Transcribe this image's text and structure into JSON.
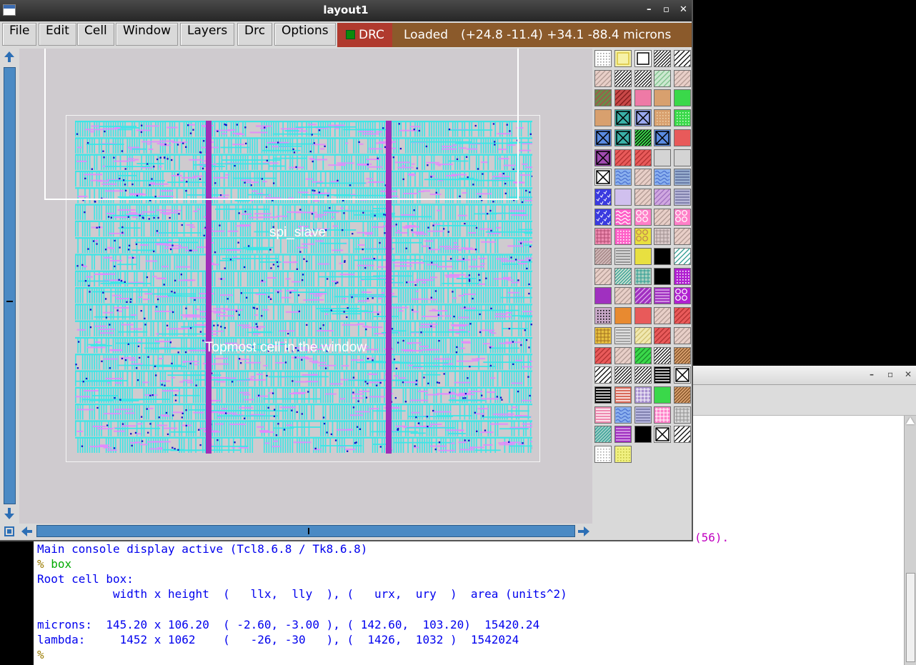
{
  "layout_window": {
    "title": "layout1",
    "controls": {
      "minimize": "–",
      "maximize": "▫",
      "close": "✕"
    },
    "menus": [
      "File",
      "Edit",
      "Cell",
      "Window",
      "Layers",
      "Drc",
      "Options"
    ],
    "drc": {
      "label": "DRC",
      "indicator_color": "#0b8a0b"
    },
    "status": {
      "state": "Loaded",
      "coords": "(+24.8 -11.4) +34.1 -88.4 microns"
    },
    "canvas": {
      "labels": {
        "cell": "spi_slave",
        "topmost": "Topmost cell in the window"
      },
      "colors": {
        "background": "#cfcbcf",
        "metal": "#3ce6e6",
        "poly": "#e585ff",
        "via": "#1111cc",
        "strap": "#a02eb8"
      }
    }
  },
  "console_window": {
    "controls": {
      "minimize": "–",
      "maximize": "▫",
      "close": "✕"
    },
    "partial_message": "(56).",
    "lines": [
      {
        "type": "output",
        "text": "Main console display active (Tcl8.6.8 / Tk8.6.8)"
      },
      {
        "type": "prompt",
        "prompt": "% ",
        "command": "box"
      },
      {
        "type": "output",
        "text": "Root cell box:"
      },
      {
        "type": "output",
        "text": "           width x height  (   llx,  lly  ), (   urx,  ury  )  area (units^2)"
      },
      {
        "type": "output",
        "text": ""
      },
      {
        "type": "output",
        "text": "microns:  145.20 x 106.20  ( -2.60, -3.00 ), ( 142.60,  103.20)  15420.24"
      },
      {
        "type": "output",
        "text": "lambda:     1452 x 1062    (   -26, -30   ), (  1426,  1032 )  1542024"
      },
      {
        "type": "prompt",
        "prompt": "%",
        "command": ""
      }
    ]
  },
  "layers": [
    {
      "bg": "#ffffff",
      "pattern": "dots",
      "color": "#9a9a9a"
    },
    {
      "bg": "#f6f2a8",
      "pattern": "outline",
      "color": "#d8c33a"
    },
    {
      "bg": "#ffffff",
      "pattern": "outline",
      "color": "#000000"
    },
    {
      "bg": "#ffffff",
      "pattern": "diag-dense",
      "color": "#000000"
    },
    {
      "bg": "#ffffff",
      "pattern": "diag",
      "color": "#000000"
    },
    {
      "bg": "#e8cfc8",
      "pattern": "diag",
      "color": "#b29a94"
    },
    {
      "bg": "#ffffff",
      "pattern": "diag-dense",
      "color": "#000000"
    },
    {
      "bg": "#ffffff",
      "pattern": "diag-dense",
      "color": "#000000"
    },
    {
      "bg": "#cce8d0",
      "pattern": "diag",
      "color": "#7cc08a"
    },
    {
      "bg": "#e8cfc8",
      "pattern": "diag",
      "color": "#b29a94"
    },
    {
      "bg": "#6b8a4a",
      "pattern": "diag",
      "color": "#b04a4a"
    },
    {
      "bg": "#c84848",
      "pattern": "diag",
      "color": "#7e1a1a"
    },
    {
      "bg": "#ee7aa6",
      "pattern": "solid",
      "color": "#ee7aa6"
    },
    {
      "bg": "#d8a06e",
      "pattern": "solid",
      "color": "#d8a06e"
    },
    {
      "bg": "#3ad84a",
      "pattern": "solid",
      "color": "#3ad84a"
    },
    {
      "bg": "#d8a06e",
      "pattern": "solid",
      "color": "#d8a06e"
    },
    {
      "bg": "#3ab0a6",
      "pattern": "cross",
      "color": "#000000"
    },
    {
      "bg": "#9aa8ee",
      "pattern": "cross",
      "color": "#000000"
    },
    {
      "bg": "#d8a06e",
      "pattern": "dots",
      "color": "#f0d0a8"
    },
    {
      "bg": "#3ad84a",
      "pattern": "dots",
      "color": "#c8ffc8"
    },
    {
      "bg": "#5a8ae0",
      "pattern": "cross",
      "color": "#000000"
    },
    {
      "bg": "#3ab0a6",
      "pattern": "cross",
      "color": "#000000"
    },
    {
      "bg": "#3ad84a",
      "pattern": "diag-dense",
      "color": "#000000"
    },
    {
      "bg": "#5a8ae0",
      "pattern": "cross",
      "color": "#000000"
    },
    {
      "bg": "#e85a5a",
      "pattern": "solid",
      "color": "#e85a5a"
    },
    {
      "bg": "#a04ab0",
      "pattern": "cross",
      "color": "#000000"
    },
    {
      "bg": "#e85a5a",
      "pattern": "diag",
      "color": "#b03030"
    },
    {
      "bg": "#e85a5a",
      "pattern": "diag",
      "color": "#b03030"
    },
    {
      "bg": "#d4d4d4",
      "pattern": "solid",
      "color": "#d4d4d4"
    },
    {
      "bg": "#d4d4d4",
      "pattern": "solid",
      "color": "#d4d4d4"
    },
    {
      "bg": "#ffffff",
      "pattern": "cross",
      "color": "#000000"
    },
    {
      "bg": "#8ab0ee",
      "pattern": "waves",
      "color": "#4a70d0"
    },
    {
      "bg": "#e8cfc8",
      "pattern": "diag",
      "color": "#b29a94"
    },
    {
      "bg": "#8ab0ee",
      "pattern": "waves",
      "color": "#4a70d0"
    },
    {
      "bg": "#9ab0d0",
      "pattern": "hlines",
      "color": "#5a6a9a"
    },
    {
      "bg": "#3a3adf",
      "pattern": "checks",
      "color": "#ffffff"
    },
    {
      "bg": "#d0c0ee",
      "pattern": "solid",
      "color": "#d0c0ee"
    },
    {
      "bg": "#e8cfc8",
      "pattern": "diag",
      "color": "#b29a94"
    },
    {
      "bg": "#d0a8e0",
      "pattern": "diag",
      "color": "#a070c0"
    },
    {
      "bg": "#b8b8d8",
      "pattern": "hlines",
      "color": "#7070a0"
    },
    {
      "bg": "#3a3adf",
      "pattern": "checks",
      "color": "#ffffff"
    },
    {
      "bg": "#ff60c8",
      "pattern": "waves",
      "color": "#ffffff"
    },
    {
      "bg": "#ff80c8",
      "pattern": "circles",
      "color": "#ffffff"
    },
    {
      "bg": "#e8cfc8",
      "pattern": "diag",
      "color": "#b29a94"
    },
    {
      "bg": "#ff80c8",
      "pattern": "circles",
      "color": "#ffffff"
    },
    {
      "bg": "#ee8ab0",
      "pattern": "grid",
      "color": "#b04a70"
    },
    {
      "bg": "#ff60c8",
      "pattern": "dots",
      "color": "#ffffff"
    },
    {
      "bg": "#e8e040",
      "pattern": "circles",
      "color": "#c08050"
    },
    {
      "bg": "#d8c8c8",
      "pattern": "grid",
      "color": "#a09090"
    },
    {
      "bg": "#e8cfc8",
      "pattern": "diag",
      "color": "#b29a94"
    },
    {
      "bg": "#d0b8b8",
      "pattern": "diag-dense",
      "color": "#a08080"
    },
    {
      "bg": "#d8d8d8",
      "pattern": "hlines",
      "color": "#808080"
    },
    {
      "bg": "#e8e040",
      "pattern": "diag",
      "color": "#e8e040"
    },
    {
      "bg": "#000000",
      "pattern": "solid",
      "color": "#000000"
    },
    {
      "bg": "#ffffff",
      "pattern": "diag",
      "color": "#2a9a90"
    },
    {
      "bg": "#e8cfc8",
      "pattern": "diag",
      "color": "#b29a94"
    },
    {
      "bg": "#c8e0d0",
      "pattern": "diag-dense",
      "color": "#2a9a90"
    },
    {
      "bg": "#a8d0c0",
      "pattern": "grid",
      "color": "#2a9a90"
    },
    {
      "bg": "#000000",
      "pattern": "solid",
      "color": "#000000"
    },
    {
      "bg": "#b020d0",
      "pattern": "dots",
      "color": "#ffffff"
    },
    {
      "bg": "#a030c0",
      "pattern": "solid",
      "color": "#a030c0"
    },
    {
      "bg": "#e8cfc8",
      "pattern": "diag",
      "color": "#b29a94"
    },
    {
      "bg": "#a030c0",
      "pattern": "diag",
      "color": "#e0b0ee"
    },
    {
      "bg": "#a030c0",
      "pattern": "hlines",
      "color": "#e0b0ee"
    },
    {
      "bg": "#b020d0",
      "pattern": "circles",
      "color": "#ffffff"
    },
    {
      "bg": "#c8a8c8",
      "pattern": "dots",
      "color": "#000000"
    },
    {
      "bg": "#e88a30",
      "pattern": "solid",
      "color": "#e88a30"
    },
    {
      "bg": "#e85a5a",
      "pattern": "solid",
      "color": "#e85a5a"
    },
    {
      "bg": "#e8cfc8",
      "pattern": "diag",
      "color": "#b29a94"
    },
    {
      "bg": "#e85a5a",
      "pattern": "diag",
      "color": "#b03030"
    },
    {
      "bg": "#e8c040",
      "pattern": "grid",
      "color": "#a07020"
    },
    {
      "bg": "#e0e0e0",
      "pattern": "hlines",
      "color": "#909090"
    },
    {
      "bg": "#f0e8b0",
      "pattern": "diag",
      "color": "#d0c070"
    },
    {
      "bg": "#e85a5a",
      "pattern": "diag",
      "color": "#b03030"
    },
    {
      "bg": "#e8cfc8",
      "pattern": "diag",
      "color": "#b29a94"
    },
    {
      "bg": "#e85a5a",
      "pattern": "diag",
      "color": "#b03030"
    },
    {
      "bg": "#e8cfc8",
      "pattern": "diag",
      "color": "#b29a94"
    },
    {
      "bg": "#3ad84a",
      "pattern": "diag",
      "color": "#1a8a2a"
    },
    {
      "bg": "#ffffff",
      "pattern": "diag-dense",
      "color": "#000000"
    },
    {
      "bg": "#d8a06e",
      "pattern": "diag-dense",
      "color": "#7a4a20"
    },
    {
      "bg": "#ffffff",
      "pattern": "diag",
      "color": "#000000"
    },
    {
      "bg": "#ffffff",
      "pattern": "diag-dense",
      "color": "#000000"
    },
    {
      "bg": "#ffffff",
      "pattern": "diag-dense",
      "color": "#000000"
    },
    {
      "bg": "#000000",
      "pattern": "hlines",
      "color": "#ffffff"
    },
    {
      "bg": "#ffffff",
      "pattern": "cross",
      "color": "#000000"
    },
    {
      "bg": "#000000",
      "pattern": "hlines",
      "color": "#ffffff"
    },
    {
      "bg": "#d86a5a",
      "pattern": "hlines",
      "color": "#ffffff"
    },
    {
      "bg": "#a890d0",
      "pattern": "grid",
      "color": "#ffffff"
    },
    {
      "bg": "#3ad84a",
      "pattern": "solid",
      "color": "#3ad84a"
    },
    {
      "bg": "#d8a06e",
      "pattern": "diag-dense",
      "color": "#7a4a20"
    },
    {
      "bg": "#ee8ab0",
      "pattern": "hlines",
      "color": "#ffffff"
    },
    {
      "bg": "#8ab0ee",
      "pattern": "waves",
      "color": "#4a70d0"
    },
    {
      "bg": "#b8b8e0",
      "pattern": "hlines",
      "color": "#7070a0"
    },
    {
      "bg": "#ff80c8",
      "pattern": "grid",
      "color": "#ffffff"
    },
    {
      "bg": "#d8d8d8",
      "pattern": "grid",
      "color": "#909090"
    },
    {
      "bg": "#a0d0c8",
      "pattern": "diag-dense",
      "color": "#2a9a90"
    },
    {
      "bg": "#a030c0",
      "pattern": "hlines",
      "color": "#e0b0ee"
    },
    {
      "bg": "#000000",
      "pattern": "solid",
      "color": "#000000"
    },
    {
      "bg": "#ffffff",
      "pattern": "cross",
      "color": "#000000"
    },
    {
      "bg": "#ffffff",
      "pattern": "diag",
      "color": "#000000"
    },
    {
      "bg": "#ffffff",
      "pattern": "dots",
      "color": "#aaaaaa"
    },
    {
      "bg": "#f0f080",
      "pattern": "dots",
      "color": "#c0c040"
    }
  ]
}
